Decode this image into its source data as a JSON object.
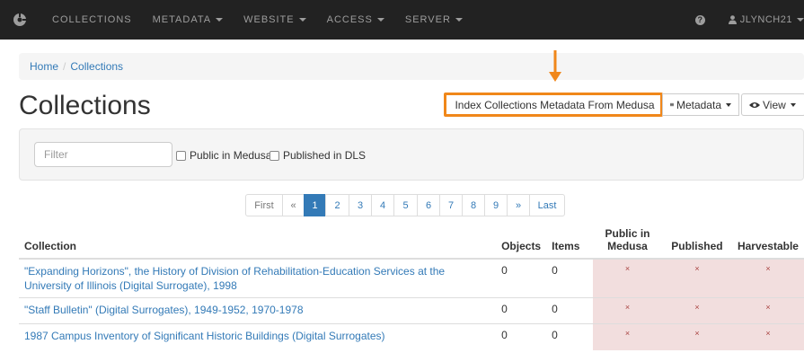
{
  "navbar": {
    "items": [
      "COLLECTIONS",
      "METADATA",
      "WEBSITE",
      "ACCESS",
      "SERVER"
    ],
    "user": "JLYNCH21"
  },
  "breadcrumb": {
    "home": "Home",
    "current": "Collections"
  },
  "page_title": "Collections",
  "buttons": {
    "index": "Index Collections Metadata From Medusa",
    "metadata": "Metadata",
    "view": "View"
  },
  "filter": {
    "placeholder": "Filter",
    "public_in_medusa": "Public in Medusa",
    "published_in_dls": "Published in DLS"
  },
  "pagination": {
    "first": "First",
    "prev": "«",
    "pages": [
      "1",
      "2",
      "3",
      "4",
      "5",
      "6",
      "7",
      "8",
      "9"
    ],
    "next": "»",
    "last": "Last",
    "current": "1"
  },
  "table": {
    "headers": {
      "collection": "Collection",
      "objects": "Objects",
      "items": "Items",
      "public_line1": "Public in",
      "public_line2": "Medusa",
      "published": "Published",
      "harvestable": "Harvestable"
    },
    "rows": [
      {
        "name": "\"Expanding Horizons\", the History of Division of Rehabilitation-Education Services at the University of Illinois (Digital Surrogate), 1998",
        "objects": "0",
        "items": "0",
        "public": "×",
        "published": "×",
        "harvestable": "×"
      },
      {
        "name": "\"Staff Bulletin\" (Digital Surrogates), 1949-1952, 1970-1978",
        "objects": "0",
        "items": "0",
        "public": "×",
        "published": "×",
        "harvestable": "×"
      },
      {
        "name": "1987 Campus Inventory of Significant Historic Buildings (Digital Surrogates)",
        "objects": "0",
        "items": "0",
        "public": "×",
        "published": "×",
        "harvestable": "×"
      }
    ]
  },
  "colors": {
    "navbar": "#222222",
    "link": "#337ab7",
    "highlight": "#f0871a",
    "danger_bg": "#f2dede"
  }
}
